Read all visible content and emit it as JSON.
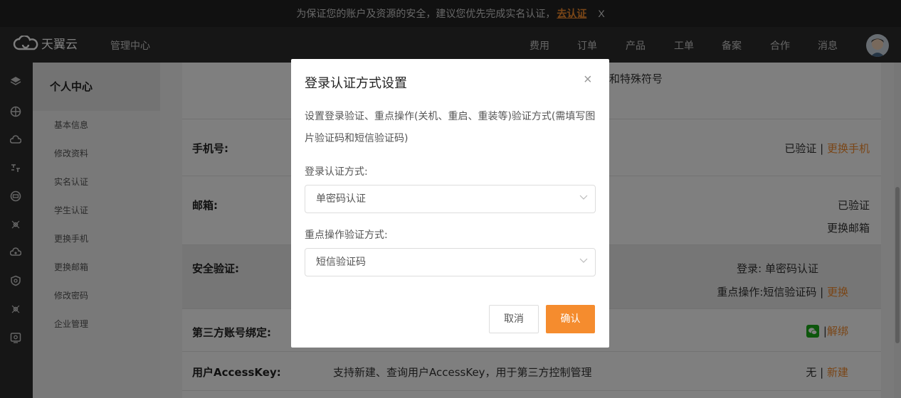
{
  "notice": {
    "text": "为保证您的账户及资源的安全，建议您优先完成实名认证，",
    "action": "去认证",
    "close": "X"
  },
  "header": {
    "brand": "天翼云",
    "section": "管理中心",
    "nav": [
      "费用",
      "订单",
      "产品",
      "工单",
      "备案",
      "合作",
      "消息"
    ]
  },
  "iconbar": [
    "layers-icon",
    "network-icon",
    "cloud-icon",
    "transfer-icon",
    "storage-icon",
    "settings-icon",
    "cdn-icon",
    "shield-icon",
    "gear-icon",
    "monitor-icon"
  ],
  "sidebar": {
    "title": "个人中心",
    "items": [
      "基本信息",
      "修改资料",
      "实名认证",
      "学生认证",
      "更换手机",
      "更换邮箱",
      "修改密码",
      "企业管理"
    ]
  },
  "main": {
    "password_hint": "和特殊符号",
    "phone": {
      "label": "手机号:",
      "status": "已验证",
      "sep": " | ",
      "action": "更换手机"
    },
    "email": {
      "label": "邮箱:",
      "status": "已验证",
      "action": "更换邮箱"
    },
    "security": {
      "label": "安全验证:",
      "login": "登录: 单密码认证",
      "ops": "重点操作:短信验证码",
      "sep": " | ",
      "action": "更换"
    },
    "third_party": {
      "label": "第三方账号绑定:",
      "sep": " | ",
      "action": "解绑"
    },
    "accesskey": {
      "label": "用户AccessKey:",
      "desc": "支持新建、查询用户AccessKey，用于第三方控制管理",
      "status": "无",
      "sep": " | ",
      "action": "新建"
    }
  },
  "modal": {
    "title": "登录认证方式设置",
    "close": "×",
    "description": "设置登录验证、重点操作(关机、重启、重装等)验证方式(需填写图片验证码和短信验证码)",
    "login_label": "登录认证方式:",
    "login_value": "单密码认证",
    "ops_label": "重点操作验证方式:",
    "ops_value": "短信验证码",
    "cancel": "取消",
    "confirm": "确认"
  },
  "colors": {
    "accent": "#f58c2e",
    "dark_bar": "#2d2d2d",
    "wechat": "#1aad19"
  }
}
